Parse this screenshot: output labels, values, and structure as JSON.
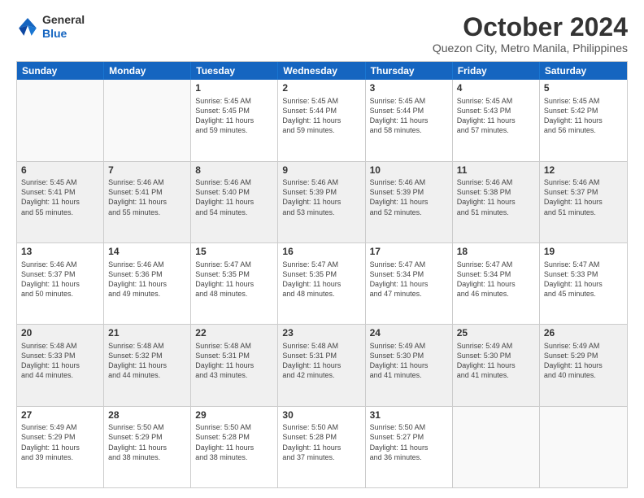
{
  "header": {
    "logo": {
      "line1": "General",
      "line2": "Blue"
    },
    "title": "October 2024",
    "subtitle": "Quezon City, Metro Manila, Philippines"
  },
  "calendar": {
    "days": [
      "Sunday",
      "Monday",
      "Tuesday",
      "Wednesday",
      "Thursday",
      "Friday",
      "Saturday"
    ],
    "rows": [
      [
        {
          "day": "",
          "info": "",
          "empty": true
        },
        {
          "day": "",
          "info": "",
          "empty": true
        },
        {
          "day": "1",
          "info": "Sunrise: 5:45 AM\nSunset: 5:45 PM\nDaylight: 11 hours\nand 59 minutes."
        },
        {
          "day": "2",
          "info": "Sunrise: 5:45 AM\nSunset: 5:44 PM\nDaylight: 11 hours\nand 59 minutes."
        },
        {
          "day": "3",
          "info": "Sunrise: 5:45 AM\nSunset: 5:44 PM\nDaylight: 11 hours\nand 58 minutes."
        },
        {
          "day": "4",
          "info": "Sunrise: 5:45 AM\nSunset: 5:43 PM\nDaylight: 11 hours\nand 57 minutes."
        },
        {
          "day": "5",
          "info": "Sunrise: 5:45 AM\nSunset: 5:42 PM\nDaylight: 11 hours\nand 56 minutes."
        }
      ],
      [
        {
          "day": "6",
          "info": "Sunrise: 5:45 AM\nSunset: 5:41 PM\nDaylight: 11 hours\nand 55 minutes.",
          "shaded": true
        },
        {
          "day": "7",
          "info": "Sunrise: 5:46 AM\nSunset: 5:41 PM\nDaylight: 11 hours\nand 55 minutes.",
          "shaded": true
        },
        {
          "day": "8",
          "info": "Sunrise: 5:46 AM\nSunset: 5:40 PM\nDaylight: 11 hours\nand 54 minutes.",
          "shaded": true
        },
        {
          "day": "9",
          "info": "Sunrise: 5:46 AM\nSunset: 5:39 PM\nDaylight: 11 hours\nand 53 minutes.",
          "shaded": true
        },
        {
          "day": "10",
          "info": "Sunrise: 5:46 AM\nSunset: 5:39 PM\nDaylight: 11 hours\nand 52 minutes.",
          "shaded": true
        },
        {
          "day": "11",
          "info": "Sunrise: 5:46 AM\nSunset: 5:38 PM\nDaylight: 11 hours\nand 51 minutes.",
          "shaded": true
        },
        {
          "day": "12",
          "info": "Sunrise: 5:46 AM\nSunset: 5:37 PM\nDaylight: 11 hours\nand 51 minutes.",
          "shaded": true
        }
      ],
      [
        {
          "day": "13",
          "info": "Sunrise: 5:46 AM\nSunset: 5:37 PM\nDaylight: 11 hours\nand 50 minutes."
        },
        {
          "day": "14",
          "info": "Sunrise: 5:46 AM\nSunset: 5:36 PM\nDaylight: 11 hours\nand 49 minutes."
        },
        {
          "day": "15",
          "info": "Sunrise: 5:47 AM\nSunset: 5:35 PM\nDaylight: 11 hours\nand 48 minutes."
        },
        {
          "day": "16",
          "info": "Sunrise: 5:47 AM\nSunset: 5:35 PM\nDaylight: 11 hours\nand 48 minutes."
        },
        {
          "day": "17",
          "info": "Sunrise: 5:47 AM\nSunset: 5:34 PM\nDaylight: 11 hours\nand 47 minutes."
        },
        {
          "day": "18",
          "info": "Sunrise: 5:47 AM\nSunset: 5:34 PM\nDaylight: 11 hours\nand 46 minutes."
        },
        {
          "day": "19",
          "info": "Sunrise: 5:47 AM\nSunset: 5:33 PM\nDaylight: 11 hours\nand 45 minutes."
        }
      ],
      [
        {
          "day": "20",
          "info": "Sunrise: 5:48 AM\nSunset: 5:33 PM\nDaylight: 11 hours\nand 44 minutes.",
          "shaded": true
        },
        {
          "day": "21",
          "info": "Sunrise: 5:48 AM\nSunset: 5:32 PM\nDaylight: 11 hours\nand 44 minutes.",
          "shaded": true
        },
        {
          "day": "22",
          "info": "Sunrise: 5:48 AM\nSunset: 5:31 PM\nDaylight: 11 hours\nand 43 minutes.",
          "shaded": true
        },
        {
          "day": "23",
          "info": "Sunrise: 5:48 AM\nSunset: 5:31 PM\nDaylight: 11 hours\nand 42 minutes.",
          "shaded": true
        },
        {
          "day": "24",
          "info": "Sunrise: 5:49 AM\nSunset: 5:30 PM\nDaylight: 11 hours\nand 41 minutes.",
          "shaded": true
        },
        {
          "day": "25",
          "info": "Sunrise: 5:49 AM\nSunset: 5:30 PM\nDaylight: 11 hours\nand 41 minutes.",
          "shaded": true
        },
        {
          "day": "26",
          "info": "Sunrise: 5:49 AM\nSunset: 5:29 PM\nDaylight: 11 hours\nand 40 minutes.",
          "shaded": true
        }
      ],
      [
        {
          "day": "27",
          "info": "Sunrise: 5:49 AM\nSunset: 5:29 PM\nDaylight: 11 hours\nand 39 minutes."
        },
        {
          "day": "28",
          "info": "Sunrise: 5:50 AM\nSunset: 5:29 PM\nDaylight: 11 hours\nand 38 minutes."
        },
        {
          "day": "29",
          "info": "Sunrise: 5:50 AM\nSunset: 5:28 PM\nDaylight: 11 hours\nand 38 minutes."
        },
        {
          "day": "30",
          "info": "Sunrise: 5:50 AM\nSunset: 5:28 PM\nDaylight: 11 hours\nand 37 minutes."
        },
        {
          "day": "31",
          "info": "Sunrise: 5:50 AM\nSunset: 5:27 PM\nDaylight: 11 hours\nand 36 minutes."
        },
        {
          "day": "",
          "info": "",
          "empty": true
        },
        {
          "day": "",
          "info": "",
          "empty": true
        }
      ]
    ]
  }
}
